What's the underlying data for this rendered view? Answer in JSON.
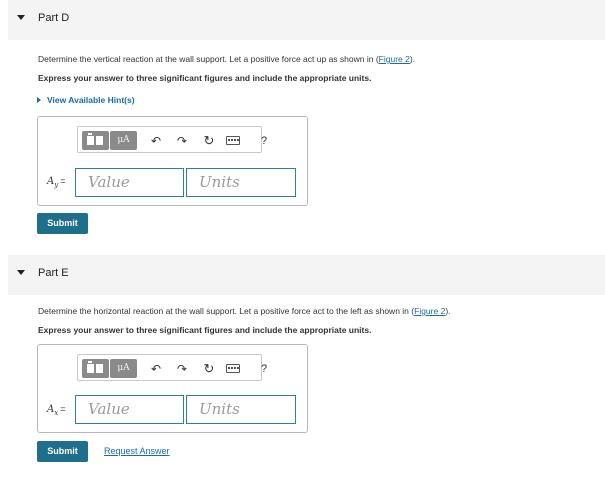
{
  "part_d": {
    "title": "Part D",
    "description": "Determine the vertical reaction at the wall support. Let a positive force act up as shown in",
    "figure_link": "Figure 2",
    "description_end": ").",
    "description_open": "(",
    "express": "Express your answer to three significant figures and include the appropriate units.",
    "hint_label": "View Available Hint(s)",
    "var_symbol": "A",
    "var_subscript": "y",
    "var_equals": "=",
    "value_placeholder": "Value",
    "units_placeholder": "Units",
    "submit_label": "Submit"
  },
  "part_e": {
    "title": "Part E",
    "description": "Determine the horizontal reaction at the wall support. Let a positive force act to the left as shown in",
    "figure_link": "Figure 2",
    "description_end": ").",
    "description_open": "(",
    "express": "Express your answer to three significant figures and include the appropriate units.",
    "var_symbol": "A",
    "var_subscript": "x",
    "var_equals": "=",
    "value_placeholder": "Value",
    "units_placeholder": "Units",
    "submit_label": "Submit",
    "request_answer_label": "Request Answer"
  },
  "toolbar": {
    "units_symbol": "μA",
    "help_symbol": "?",
    "icons": [
      "templates-icon",
      "units-icon",
      "undo-icon",
      "redo-icon",
      "reset-icon",
      "keyboard-icon",
      "help-icon"
    ]
  },
  "colors": {
    "accent": "#1d6f8c",
    "link": "#1a6aa8",
    "header_bg": "#f4f4f4"
  }
}
